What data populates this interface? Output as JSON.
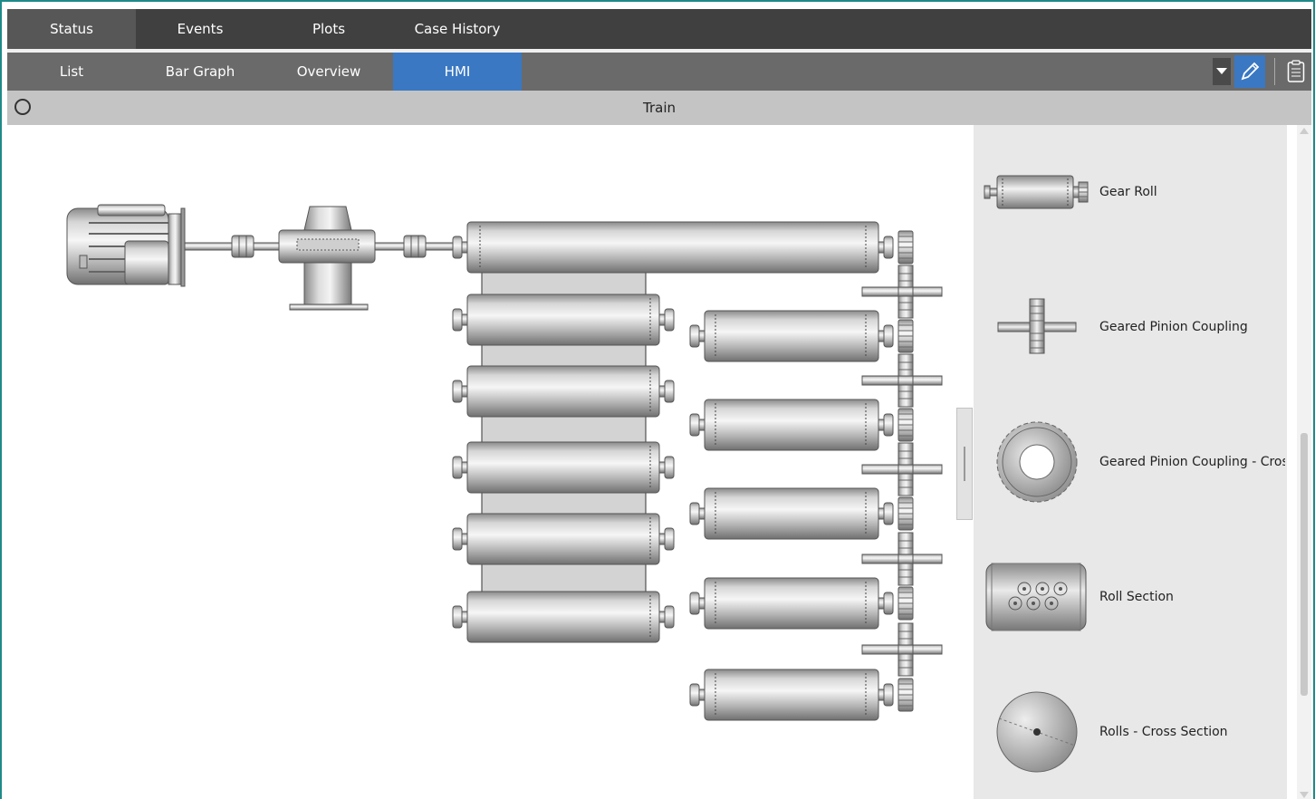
{
  "tabs": [
    {
      "label": "Status",
      "active": true
    },
    {
      "label": "Events"
    },
    {
      "label": "Plots"
    },
    {
      "label": "Case History"
    }
  ],
  "subtabs": [
    {
      "label": "List"
    },
    {
      "label": "Bar Graph"
    },
    {
      "label": "Overview"
    },
    {
      "label": "HMI",
      "active": true
    }
  ],
  "toolbar": {
    "icons": [
      "dropdown-arrow-icon",
      "edit-pencil-icon",
      "clipboard-icon"
    ]
  },
  "header": {
    "title": "Train",
    "status_icon": "circle-status-icon"
  },
  "palette": {
    "items": [
      {
        "label": "Gear Roll",
        "icon": "gear-roll-icon"
      },
      {
        "label": "Geared Pinion Coupling",
        "icon": "geared-pinion-coupling-icon"
      },
      {
        "label": "Geared Pinion Coupling - Cros",
        "icon": "geared-pinion-cross-section-icon"
      },
      {
        "label": "Roll Section",
        "icon": "roll-section-icon"
      },
      {
        "label": "Rolls - Cross Section",
        "icon": "rolls-cross-section-icon"
      }
    ]
  },
  "diagram": {
    "components": [
      "motor",
      "gearbox",
      "couplings",
      "top-gear-roll",
      "left-rolls",
      "right-rolls",
      "pinion-couplings"
    ]
  },
  "colors": {
    "accent": "#3a78c3",
    "tabbar": "#404040",
    "subtabbar": "#6a6a6a",
    "border": "#1f8a8a"
  }
}
